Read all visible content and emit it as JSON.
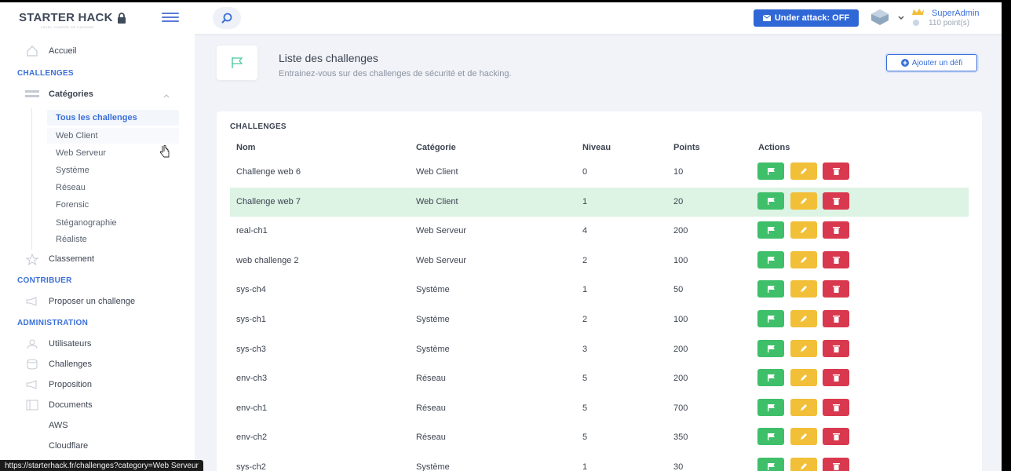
{
  "header": {
    "logo_text": "STARTER HACK",
    "logo_tagline": "LEVEL CHARGE DE HACKING",
    "attack_label": "Under attack: OFF",
    "user_name": "SuperAdmin",
    "user_points": "110 point(s)"
  },
  "sidebar": {
    "home": "Accueil",
    "section_challenges": "CHALLENGES",
    "categories": "Catégories",
    "subitems": [
      "Tous les challenges",
      "Web Client",
      "Web Serveur",
      "Système",
      "Réseau",
      "Forensic",
      "Stéganographie",
      "Réaliste"
    ],
    "ranking": "Classement",
    "section_contribute": "CONTRIBUER",
    "propose": "Proposer un challenge",
    "section_admin": "ADMINISTRATION",
    "admin_items": [
      "Utilisateurs",
      "Challenges",
      "Proposition",
      "Documents",
      "AWS",
      "Cloudflare"
    ]
  },
  "main": {
    "title": "Liste des challenges",
    "subtitle": "Entrainez-vous sur des challenges de sécurité et de hacking.",
    "add_button": "Ajouter un défi",
    "card_title": "CHALLENGES",
    "columns": [
      "Nom",
      "Catégorie",
      "Niveau",
      "Points",
      "Actions"
    ],
    "rows": [
      {
        "name": "Challenge web 6",
        "category": "Web Client",
        "level": "0",
        "points": "10"
      },
      {
        "name": "Challenge web 7",
        "category": "Web Client",
        "level": "1",
        "points": "20"
      },
      {
        "name": "real-ch1",
        "category": "Web Serveur",
        "level": "4",
        "points": "200"
      },
      {
        "name": "web challenge 2",
        "category": "Web Serveur",
        "level": "2",
        "points": "100"
      },
      {
        "name": "sys-ch4",
        "category": "Système",
        "level": "1",
        "points": "50"
      },
      {
        "name": "sys-ch1",
        "category": "Système",
        "level": "2",
        "points": "100"
      },
      {
        "name": "sys-ch3",
        "category": "Système",
        "level": "3",
        "points": "200"
      },
      {
        "name": "env-ch3",
        "category": "Réseau",
        "level": "5",
        "points": "200"
      },
      {
        "name": "env-ch1",
        "category": "Réseau",
        "level": "5",
        "points": "700"
      },
      {
        "name": "env-ch2",
        "category": "Réseau",
        "level": "5",
        "points": "350"
      },
      {
        "name": "sys-ch2",
        "category": "Système",
        "level": "1",
        "points": "30"
      }
    ]
  },
  "status_bar_url": "https://starterhack.fr/challenges?category=Web Serveur",
  "colors": {
    "accent": "#3a6fd8",
    "flag": "#3fbf6a",
    "edit": "#f2bf38",
    "delete": "#d9394e",
    "highlight_row": "#ddf3e4"
  }
}
